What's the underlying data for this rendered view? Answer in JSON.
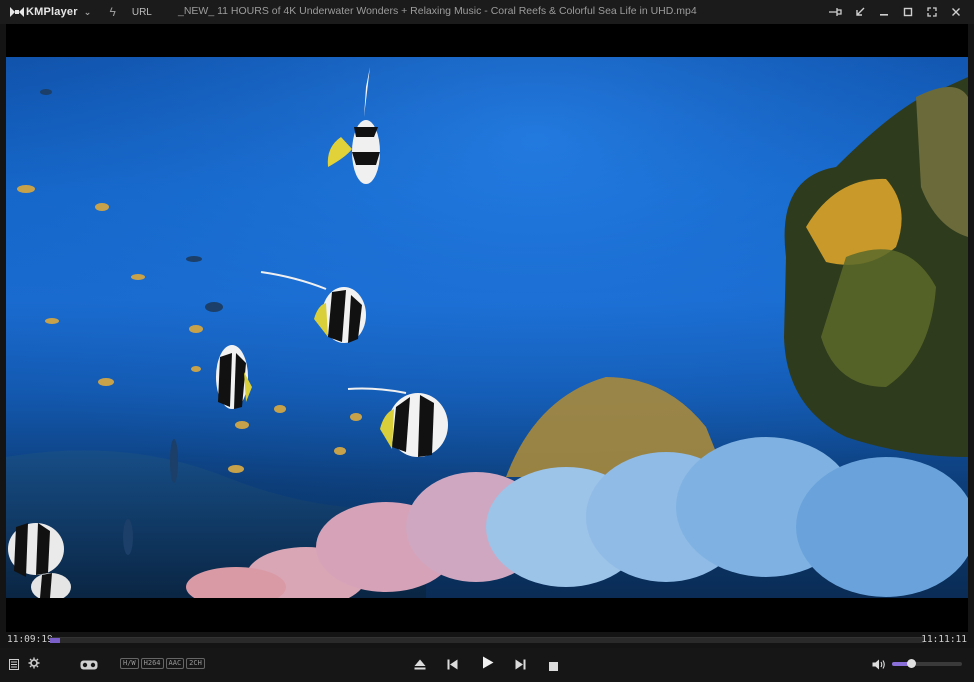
{
  "app": {
    "brand": "KMPlayer",
    "url_label": "URL",
    "file_title": "_NEW_ 11 HOURS of 4K Underwater Wonders + Relaxing Music - Coral Reefs & Colorful Sea Life in UHD.mp4"
  },
  "window_controls": [
    "pin-icon",
    "shrink-icon",
    "minimize-icon",
    "maximize-icon",
    "fullscreen-icon",
    "close-icon"
  ],
  "playback": {
    "elapsed": "11:09:19",
    "total": "11:11:11",
    "progress": 0.003
  },
  "badges": [
    "H/W",
    "H264",
    "AAC",
    "2CH"
  ],
  "volume": {
    "level": 0.27
  },
  "colors": {
    "accent": "#7a5fc8"
  }
}
